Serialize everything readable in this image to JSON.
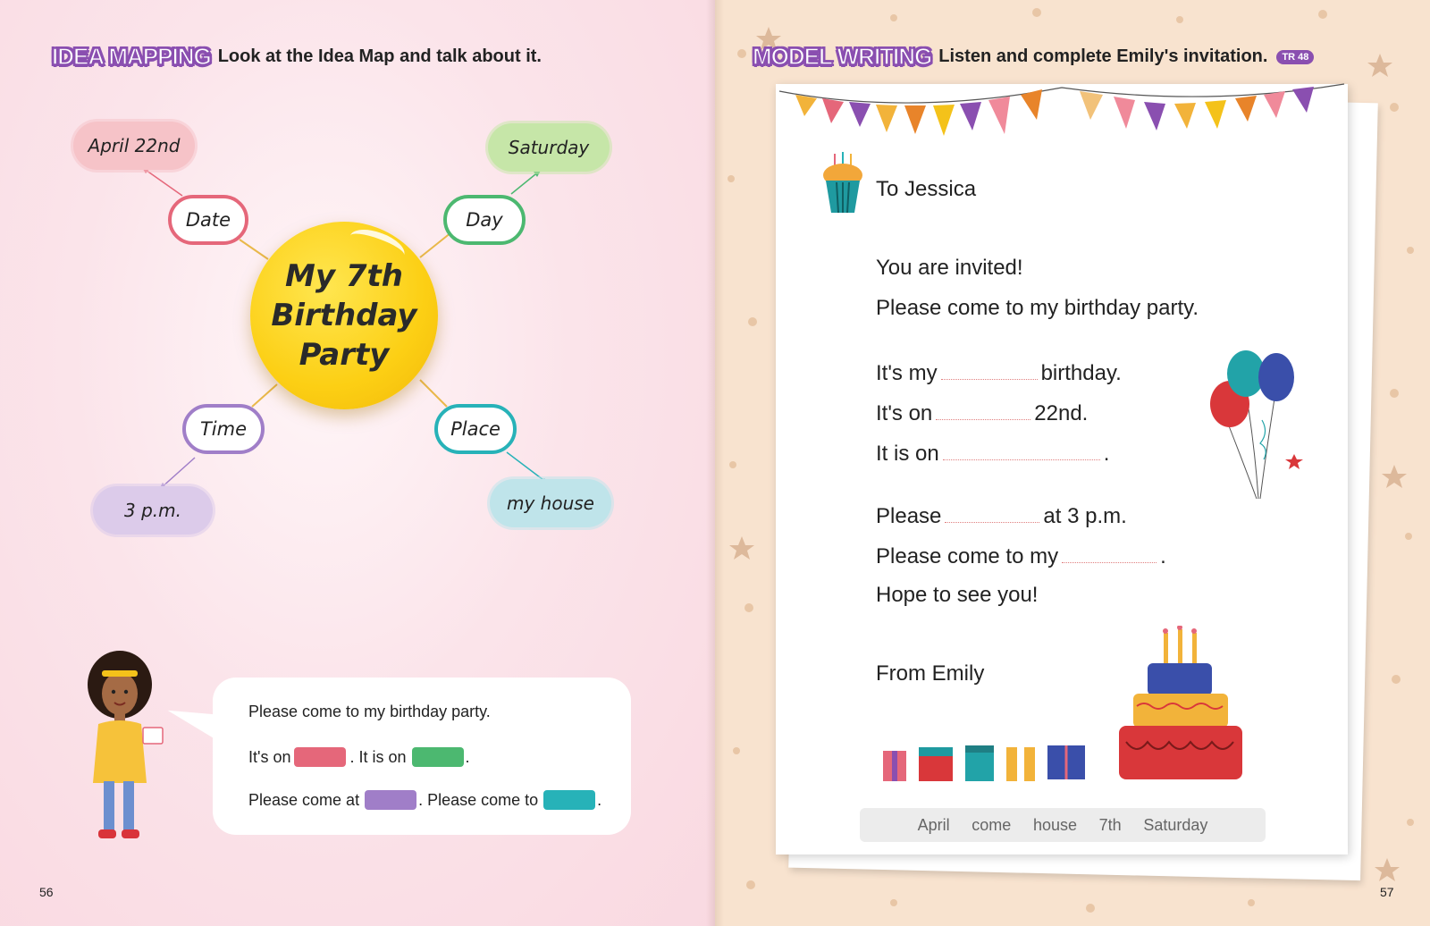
{
  "left_page": {
    "section_badge": "IDEA MAPPING",
    "instruction": "Look at the Idea Map and talk about it.",
    "page_number": "56",
    "map": {
      "center": "My 7th Birthday Party",
      "branches": [
        {
          "label": "Date",
          "value": "April 22nd",
          "color": "#e5677a",
          "leaf_color": "#f6c3c8"
        },
        {
          "label": "Day",
          "value": "Saturday",
          "color": "#4cb870",
          "leaf_color": "#c6e6a8"
        },
        {
          "label": "Time",
          "value": "3 p.m.",
          "color": "#a07ec8",
          "leaf_color": "#dccbea"
        },
        {
          "label": "Place",
          "value": "my house",
          "color": "#27b2b8",
          "leaf_color": "#bfe4ea"
        }
      ]
    },
    "bubble": {
      "line1": "Please come to my birthday party.",
      "line2_a": "It's on",
      "line2_b": ". It is on",
      "line2_c": ".",
      "line3_a": "Please come at",
      "line3_b": ". Please come to",
      "line3_c": ".",
      "colors": {
        "date": "#e5677a",
        "day": "#4cb870",
        "time": "#a07ec8",
        "place": "#27b2b8"
      }
    }
  },
  "right_page": {
    "section_badge": "MODEL WRITING",
    "instruction": "Listen and complete Emily's invitation.",
    "track": "TR 48",
    "page_number": "57",
    "letter": {
      "to": "To Jessica",
      "l1": "You are invited!",
      "l2": "Please come to my birthday party.",
      "l3_a": "It's my",
      "l3_b": "birthday.",
      "l4_a": "It's on",
      "l4_b": "22nd.",
      "l5_a": "It is on",
      "l5_b": ".",
      "l6_a": "Please",
      "l6_b": "at 3 p.m.",
      "l7_a": "Please come to my",
      "l7_b": ".",
      "l8": "Hope to see you!",
      "from": "From Emily"
    },
    "word_bank": [
      "April",
      "come",
      "house",
      "7th",
      "Saturday"
    ]
  },
  "icons": [
    "cupcake-icon",
    "balloons-icon",
    "birthday-cake-icon",
    "gift-box-icon",
    "bunting-flags-icon",
    "girl-character-icon"
  ]
}
